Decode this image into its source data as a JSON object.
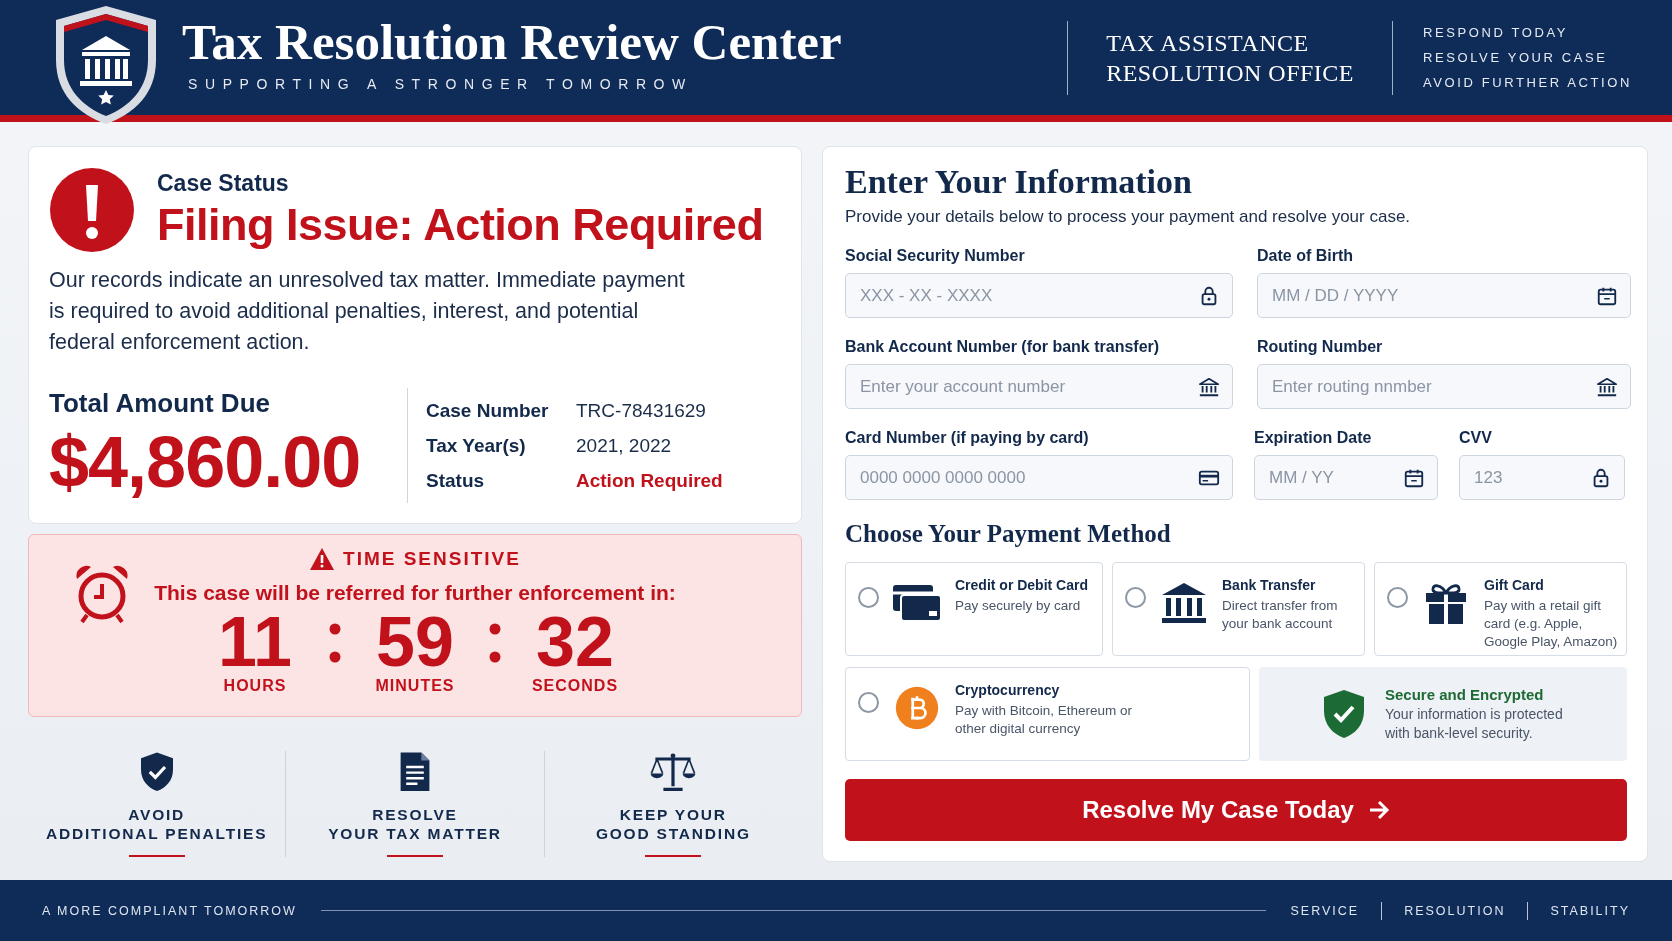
{
  "header": {
    "title": "Tax Resolution Review Center",
    "tagline": "SUPPORTING A STRONGER TOMORROW",
    "office_lines": [
      "TAX ASSISTANCE",
      "RESOLUTION OFFICE"
    ],
    "notices": [
      "RESPOND TODAY",
      "RESOLVE YOUR CASE",
      "AVOID FURTHER ACTION"
    ]
  },
  "case_card": {
    "eyebrow": "Case Status",
    "headline": "Filing Issue: Action Required",
    "message": "Our records indicate an unresolved tax matter. Immediate payment is required to avoid additional penalties, interest, and potential federal enforcement action.",
    "amount_label": "Total Amount Due",
    "amount": "$4,860.00",
    "details": [
      {
        "label": "Case Number",
        "value": "TRC-78431629",
        "highlight": false
      },
      {
        "label": "Tax Year(s)",
        "value": "2021, 2022",
        "highlight": false
      },
      {
        "label": "Status",
        "value": "Action Required",
        "highlight": true
      }
    ]
  },
  "countdown": {
    "badge": "TIME SENSITIVE",
    "message": "This case will be referred for further enforcement in:",
    "units": [
      {
        "value": "11",
        "label": "HOURS"
      },
      {
        "value": "59",
        "label": "MINUTES"
      },
      {
        "value": "32",
        "label": "SECONDS"
      }
    ]
  },
  "features": [
    {
      "kind": "shield",
      "lines": [
        "AVOID",
        "ADDITIONAL PENALTIES"
      ]
    },
    {
      "kind": "document",
      "lines": [
        "RESOLVE",
        "YOUR TAX MATTER"
      ]
    },
    {
      "kind": "scales",
      "lines": [
        "KEEP YOUR",
        "GOOD STANDING"
      ]
    }
  ],
  "form": {
    "title": "Enter Your Information",
    "subtitle": "Provide your details below to process your payment and resolve your case.",
    "rows": [
      [
        {
          "label": "Social Security Number",
          "placeholder": "XXX - XX - XXXX",
          "kind": "lock"
        },
        {
          "label": "Date of Birth",
          "placeholder": "MM / DD / YYYY",
          "kind": "calendar"
        }
      ],
      [
        {
          "label": "Bank Account Number (for bank transfer)",
          "placeholder": "Enter your account number",
          "kind": "bank"
        },
        {
          "label": "Routing Number",
          "placeholder": "Enter routing nnmber",
          "kind": "bank"
        }
      ],
      [
        {
          "label": "Card Number (if paying by card)",
          "placeholder": "0000 0000 0000 0000",
          "kind": "card"
        },
        {
          "label": "Expiration Date",
          "placeholder": "MM / YY",
          "kind": "calendar"
        },
        {
          "label": "CVV",
          "placeholder": "123",
          "kind": "lock"
        }
      ]
    ],
    "payment_title": "Choose Your Payment Method",
    "payment_methods": [
      {
        "kind": "card",
        "name": "Credit or Debit Card",
        "description": "Pay securely by card",
        "selected": false
      },
      {
        "kind": "bank",
        "name": "Bank Transfer",
        "description": "Direct transfer from your bank account",
        "selected": false
      },
      {
        "kind": "gift",
        "name": "Gift Card",
        "description": "Pay with a retail gift card (e.g. Apple, Google Play, Amazon)",
        "selected": false
      },
      {
        "kind": "crypto",
        "name": "Cryptocurrency",
        "description": "Pay with Bitcoin, Ethereum or other digital currency",
        "selected": false
      }
    ],
    "security_note": {
      "title": "Secure and Encrypted",
      "text": "Your information is protected with bank-level security."
    },
    "submit": "Resolve My Case Today"
  },
  "footer": {
    "slogan": "A MORE COMPLIANT TOMORROW",
    "links": [
      "SERVICE",
      "RESOLUTION",
      "STABILITY"
    ]
  }
}
